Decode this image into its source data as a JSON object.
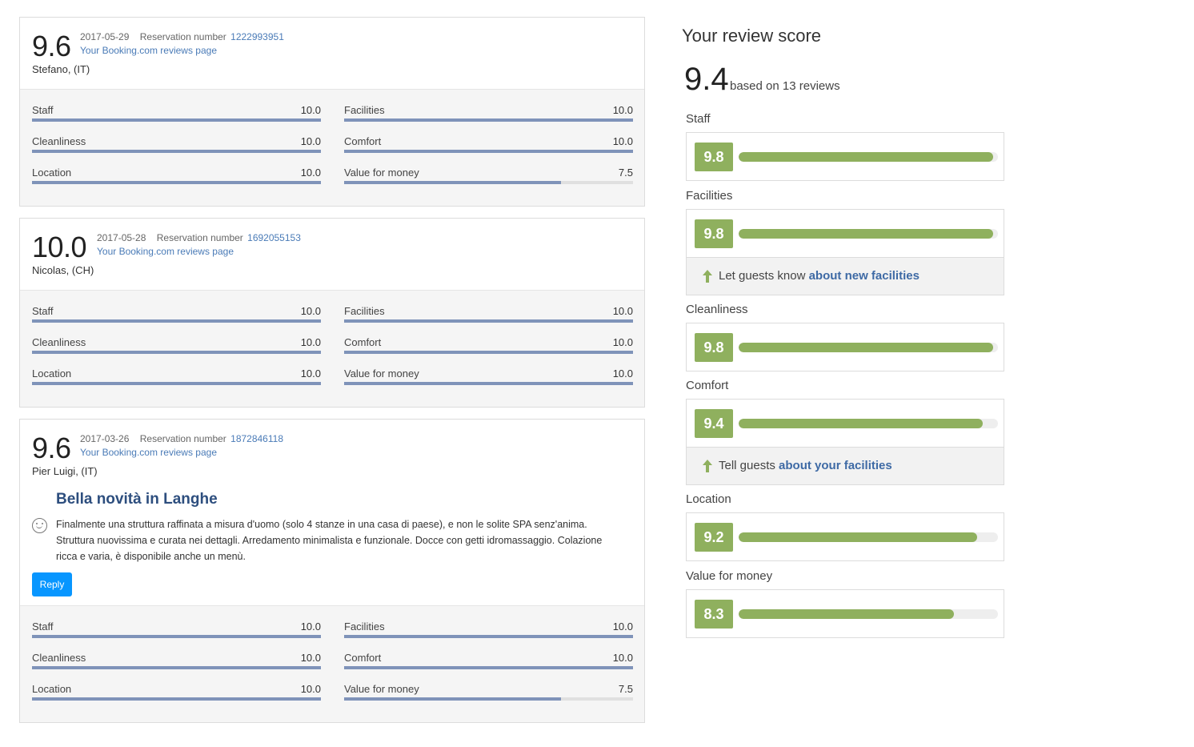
{
  "reviews": [
    {
      "score": "9.6",
      "date": "2017-05-29",
      "reservation_label": "Reservation number",
      "reservation_number": "1222993951",
      "page_link": "Your Booking.com reviews page",
      "guest": "Stefano, (IT)",
      "scores": [
        {
          "label": "Staff",
          "value": "10.0",
          "fraction": 1.0
        },
        {
          "label": "Facilities",
          "value": "10.0",
          "fraction": 1.0
        },
        {
          "label": "Cleanliness",
          "value": "10.0",
          "fraction": 1.0
        },
        {
          "label": "Comfort",
          "value": "10.0",
          "fraction": 1.0
        },
        {
          "label": "Location",
          "value": "10.0",
          "fraction": 1.0
        },
        {
          "label": "Value for money",
          "value": "7.5",
          "fraction": 0.75
        }
      ]
    },
    {
      "score": "10.0",
      "date": "2017-05-28",
      "reservation_label": "Reservation number",
      "reservation_number": "1692055153",
      "page_link": "Your Booking.com reviews page",
      "guest": "Nicolas, (CH)",
      "scores": [
        {
          "label": "Staff",
          "value": "10.0",
          "fraction": 1.0
        },
        {
          "label": "Facilities",
          "value": "10.0",
          "fraction": 1.0
        },
        {
          "label": "Cleanliness",
          "value": "10.0",
          "fraction": 1.0
        },
        {
          "label": "Comfort",
          "value": "10.0",
          "fraction": 1.0
        },
        {
          "label": "Location",
          "value": "10.0",
          "fraction": 1.0
        },
        {
          "label": "Value for money",
          "value": "10.0",
          "fraction": 1.0
        }
      ]
    },
    {
      "score": "9.6",
      "date": "2017-03-26",
      "reservation_label": "Reservation number",
      "reservation_number": "1872846118",
      "page_link": "Your Booking.com reviews page",
      "guest": "Pier Luigi, (IT)",
      "title": "Bella novità in Langhe",
      "text": "Finalmente una struttura raffinata a misura d'uomo (solo 4 stanze in una casa di paese), e non le solite SPA senz'anima. Struttura nuovissima e curata nei dettagli. Arredamento minimalista e funzionale. Docce con getti idromassaggio. Colazione ricca e varia, è disponibile anche un menù.",
      "reply_label": "Reply",
      "scores": [
        {
          "label": "Staff",
          "value": "10.0",
          "fraction": 1.0
        },
        {
          "label": "Facilities",
          "value": "10.0",
          "fraction": 1.0
        },
        {
          "label": "Cleanliness",
          "value": "10.0",
          "fraction": 1.0
        },
        {
          "label": "Comfort",
          "value": "10.0",
          "fraction": 1.0
        },
        {
          "label": "Location",
          "value": "10.0",
          "fraction": 1.0
        },
        {
          "label": "Value for money",
          "value": "7.5",
          "fraction": 0.75
        }
      ]
    }
  ],
  "summary": {
    "title": "Your review score",
    "score": "9.4",
    "based_on": "based on 13 reviews",
    "categories": [
      {
        "label": "Staff",
        "score": "9.8",
        "fraction": 0.98
      },
      {
        "label": "Facilities",
        "score": "9.8",
        "fraction": 0.98,
        "tip_prefix": "Let guests know ",
        "tip_link": "about new facilities"
      },
      {
        "label": "Cleanliness",
        "score": "9.8",
        "fraction": 0.98
      },
      {
        "label": "Comfort",
        "score": "9.4",
        "fraction": 0.94,
        "tip_prefix": "Tell guests ",
        "tip_link": "about your facilities"
      },
      {
        "label": "Location",
        "score": "9.2",
        "fraction": 0.92
      },
      {
        "label": "Value for money",
        "score": "8.3",
        "fraction": 0.83
      }
    ]
  },
  "colors": {
    "badge_green": "#8fb05e",
    "sub_bar_blue": "#7f93b9",
    "link_blue": "#4a7bb7",
    "reply_blue": "#0896ff"
  }
}
